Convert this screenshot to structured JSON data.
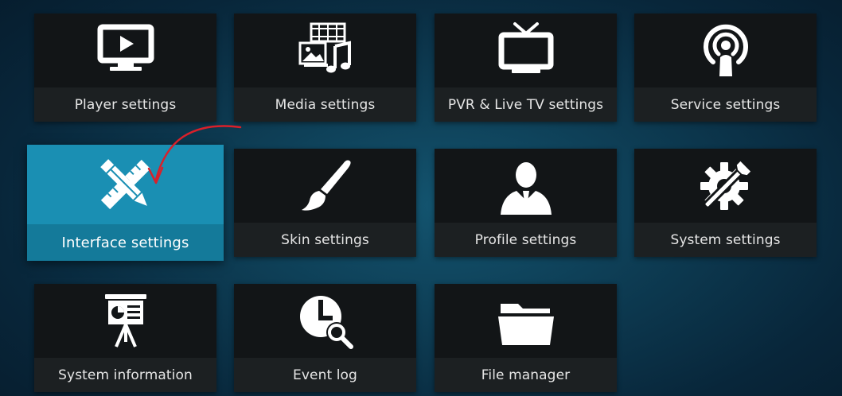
{
  "menu": {
    "player": {
      "label": "Player settings",
      "icon": "tv-play-icon"
    },
    "media": {
      "label": "Media settings",
      "icon": "media-library-icon"
    },
    "pvr": {
      "label": "PVR & Live TV settings",
      "icon": "tv-antenna-icon"
    },
    "service": {
      "label": "Service settings",
      "icon": "broadcast-person-icon"
    },
    "interface": {
      "label": "Interface settings",
      "icon": "pencil-ruler-icon",
      "focused": true
    },
    "skin": {
      "label": "Skin settings",
      "icon": "paintbrush-icon"
    },
    "profile": {
      "label": "Profile settings",
      "icon": "person-silhouette-icon"
    },
    "system": {
      "label": "System settings",
      "icon": "gear-wrench-icon"
    },
    "sysinfo": {
      "label": "System information",
      "icon": "presentation-board-icon"
    },
    "eventlog": {
      "label": "Event log",
      "icon": "clock-magnifier-icon"
    },
    "filemanager": {
      "label": "File manager",
      "icon": "folder-icon"
    }
  },
  "colors": {
    "background": "#0d3b52",
    "tile": "#121517",
    "tile_label_bar": "#1c2022",
    "focus": "#1a8fb3",
    "annotation_arrow": "#d9202a"
  }
}
